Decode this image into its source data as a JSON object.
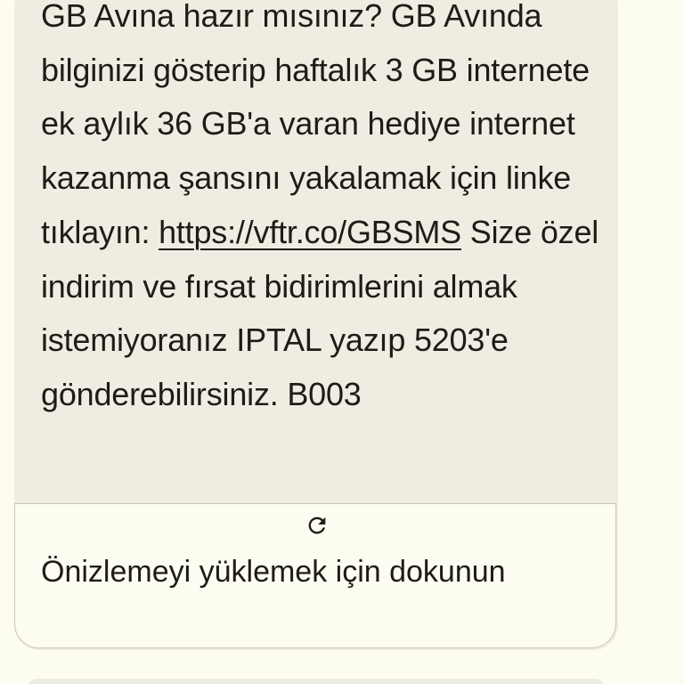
{
  "message": {
    "text_before_link": "GB Avına hazır mısınız? GB Avında bilginizi gösterip haftalık 3 GB internete ek aylık 36 GB'a varan hediye internet kazanma şansını yakalamak için linke tıklayın: ",
    "link": "https://vftr.co/GBSMS",
    "text_after_link": " Size özel indirim ve fırsat bidirimlerini almak istemiyoranız IPTAL yazıp 5203'e gönderebilirsiniz. B003"
  },
  "preview": {
    "icon": "refresh-icon",
    "label": "Önizlemeyi yüklemek için dokunun"
  },
  "colors": {
    "page_background": "#fdfcf0",
    "bubble_background": "#efede1",
    "text": "#1e1c16",
    "card_border": "#c9c7b8"
  }
}
